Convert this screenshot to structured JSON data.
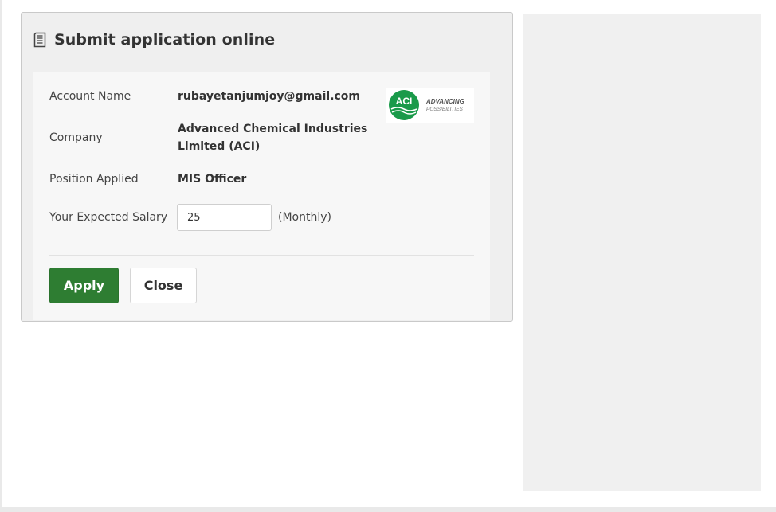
{
  "modal": {
    "title": "Submit application online",
    "fields": {
      "account_name_label": "Account Name",
      "account_name_value": "rubayetanjumjoy@gmail.com",
      "company_label": "Company",
      "company_value_line1": "Advanced Chemical Industries",
      "company_value_line2": "Limited (ACI)",
      "position_label": "Position Applied",
      "position_value": "MIS Officer",
      "salary_label": "Your Expected Salary",
      "salary_value": "25",
      "salary_unit": "(Monthly)"
    },
    "logo": {
      "mark_text": "ACI",
      "tagline_line1": "ADVANCING",
      "tagline_line2": "POSSIBILITIES"
    },
    "buttons": {
      "apply_label": "Apply",
      "close_label": "Close"
    }
  },
  "colors": {
    "apply_green": "#2e7d32",
    "logo_green": "#1a9a4a"
  },
  "icons": {
    "header_icon": "document-icon"
  }
}
